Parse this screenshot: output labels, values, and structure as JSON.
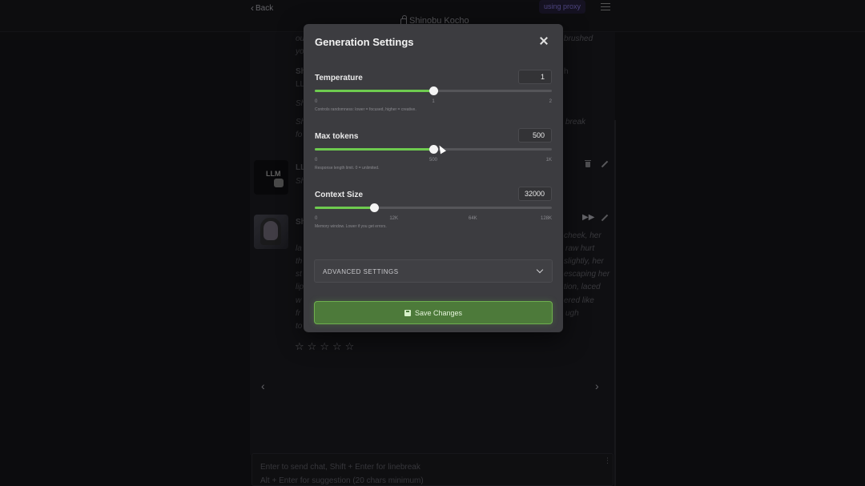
{
  "topbar": {
    "back_label": "Back",
    "title": "Shinobu Kocho",
    "proxy_badge": "using proxy"
  },
  "chat": {
    "fragments": [
      "ou",
      "brushed",
      "yo",
      "Sh",
      "LL",
      "Sh",
      "Sh",
      "break",
      "fo",
      "LL",
      "Sh",
      "Sh",
      "cheek, her",
      "la",
      "raw hurt",
      "th",
      "slightly, her",
      "st",
      "escaping her",
      "lip",
      "tion, laced",
      "w",
      "ered like",
      "fr",
      "ugh",
      "to",
      "h"
    ],
    "llm_avatar_text": "LLM",
    "input_placeholder_line1": "Enter to send chat, Shift + Enter for linebreak",
    "input_placeholder_line2": "Alt + Enter for suggestion (20 chars minimum)"
  },
  "modal": {
    "title": "Generation Settings",
    "settings": [
      {
        "label": "Temperature",
        "value": "1",
        "fill_fraction": 0.5,
        "ticks": [
          "0",
          "1",
          "2"
        ],
        "hint": "Controls randomness: lower = focused, higher = creative."
      },
      {
        "label": "Max tokens",
        "value": "500",
        "fill_fraction": 0.5,
        "ticks": [
          "0",
          "500",
          "1K"
        ],
        "hint": "Response length limit. 0 = unlimited."
      },
      {
        "label": "Context Size",
        "value": "32000",
        "fill_fraction": 0.25,
        "ticks": [
          "0",
          "12K",
          "64K",
          "128K"
        ],
        "hint": "Memory window. Lower if you get errors."
      }
    ],
    "advanced_label": "ADVANCED SETTINGS",
    "save_label": "Save Changes"
  },
  "colors": {
    "accent": "#6ecb4f",
    "modal_bg": "#3c3c40",
    "save_bg": "#4d7a3a"
  }
}
